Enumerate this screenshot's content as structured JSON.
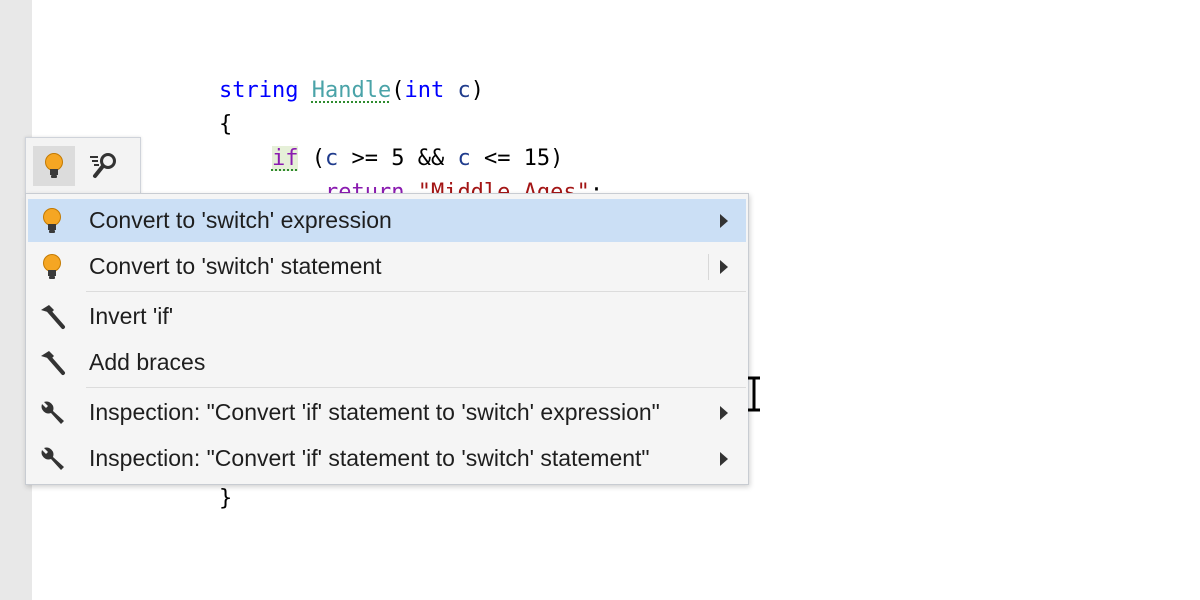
{
  "code": {
    "line1": {
      "kw_string": "string",
      "fn": "Handle",
      "paren_open": "(",
      "kw_int": "int",
      "space": " ",
      "var_c": "c",
      "paren_close": ")"
    },
    "line2": {
      "brace": "{"
    },
    "line3": {
      "indent": "    ",
      "kw_if": "if",
      "rest1": " (",
      "c1": "c",
      "rest2": " >= 5 && ",
      "c2": "c",
      "rest3": " <= 15)"
    },
    "line4": {
      "indent": "        ",
      "kw_return": "return",
      "space": " ",
      "str": "\"Middle Ages\"",
      "semi": ";"
    },
    "line_last": {
      "brace": "}"
    }
  },
  "toolbar": {
    "icons": [
      "lightbulb-icon",
      "find-usages-icon"
    ]
  },
  "menu": {
    "items": [
      {
        "label": "Convert to 'switch' expression",
        "icon": "lightbulb-icon",
        "submenu": true,
        "selected": true
      },
      {
        "label": "Convert to 'switch' statement",
        "icon": "lightbulb-icon",
        "submenu": true,
        "selected": false
      },
      {
        "label": "Invert 'if'",
        "icon": "hammer-icon",
        "submenu": false,
        "selected": false
      },
      {
        "label": "Add braces",
        "icon": "hammer-icon",
        "submenu": false,
        "selected": false
      },
      {
        "label": "Inspection: \"Convert 'if' statement to 'switch' expression\"",
        "icon": "wrench-icon",
        "submenu": true,
        "selected": false
      },
      {
        "label": "Inspection: \"Convert 'if' statement to 'switch' statement\"",
        "icon": "wrench-icon",
        "submenu": true,
        "selected": false
      }
    ]
  },
  "colors": {
    "selection": "#cbdff5",
    "keyword": "#0000ff",
    "control_keyword": "#8a1bb0",
    "method": "#4aa3a8",
    "string": "#a31515",
    "bulb": "#f5a623"
  }
}
